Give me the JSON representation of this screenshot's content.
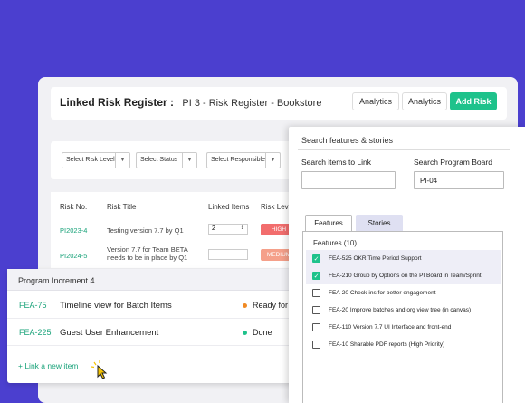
{
  "header": {
    "title": "Linked Risk Register :",
    "subtitle": "PI 3 - Risk Register - Bookstore",
    "buttons": [
      "Analytics",
      "Analytics",
      "Add Risk"
    ]
  },
  "filters": [
    "Select Risk Level",
    "Select Status",
    "Select Responsible"
  ],
  "table": {
    "columns": [
      "Risk No.",
      "Risk Title",
      "Linked Items",
      "Risk Level"
    ],
    "rows": [
      {
        "id": "PI2023-4",
        "title": "Testing version 7.7 by Q1",
        "linked": "2",
        "level": "HIGH"
      },
      {
        "id": "PI2024-5",
        "title": "Version 7.7 for Team BETA needs to be in place by Q1",
        "linked": "",
        "level": "MEDIUM"
      }
    ]
  },
  "program_increment": {
    "title": "Program Increment 4",
    "items": [
      {
        "id": "FEA-75",
        "title": "Timeline view for Batch Items",
        "status": "Ready for",
        "status_color": "#f08a24"
      },
      {
        "id": "FEA-225",
        "title": "Guest User Enhancement",
        "status": "Done",
        "status_color": "#1ec28b"
      }
    ],
    "link_label": "+ Link a new item"
  },
  "panel": {
    "title": "Search features & stories",
    "search_items_label": "Search items to Link",
    "search_items_value": "",
    "program_board_label": "Search Program Board",
    "program_board_value": "PI-04",
    "tabs": [
      "Features",
      "Stories"
    ],
    "features_heading": "Features (10)",
    "features": [
      {
        "label": "FEA-525 OKR Time Period Support",
        "checked": true
      },
      {
        "label": "FEA-210 Group by Options on the PI Board in Team/Sprint",
        "checked": true
      },
      {
        "label": "FEA-20 Check-ins for better engagement",
        "checked": false
      },
      {
        "label": "FEA-20 Improve batches and org view tree (in canvas)",
        "checked": false
      },
      {
        "label": "FEA-110 Version 7.7 UI Interface and front-end",
        "checked": false
      },
      {
        "label": "FEA-10 Sharable PDF reports (High Priority)",
        "checked": false
      }
    ]
  },
  "colors": {
    "background": "#4b3fcf",
    "accent": "#1ec28b",
    "high_badge": "#f26d6d",
    "medium_badge": "#f5a08a"
  }
}
